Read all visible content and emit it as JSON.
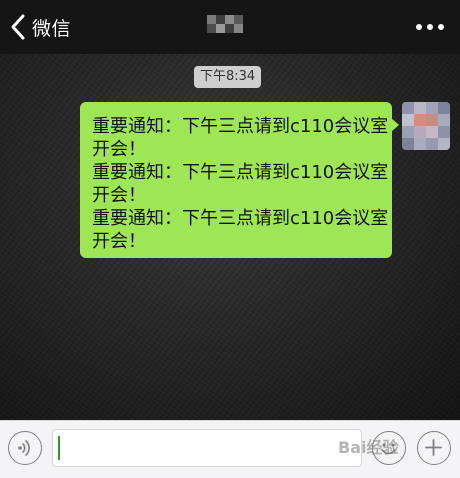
{
  "header": {
    "back_label": "微信",
    "back_icon": "chevron-left-icon",
    "more_icon": "more-dots-icon"
  },
  "chat": {
    "timestamp": "下午8:34",
    "messages": [
      {
        "sender": "self",
        "lines": [
          "重要通知：下午三点请到c110会议室",
          "开会！",
          "重要通知：下午三点请到c110会议室",
          "开会！",
          "重要通知：下午三点请到c110会议室",
          "开会！"
        ]
      }
    ]
  },
  "input_bar": {
    "voice_icon": "voice-icon",
    "emoji_icon": "emoji-icon",
    "add_icon": "add-icon",
    "value": ""
  },
  "watermark": {
    "text": "Bai经验"
  },
  "colors": {
    "header_bg": "#151515",
    "bubble_green": "#9fe657",
    "timestamp_bg": "#cfcfcf",
    "input_bar_bg": "#f4f4f6"
  }
}
